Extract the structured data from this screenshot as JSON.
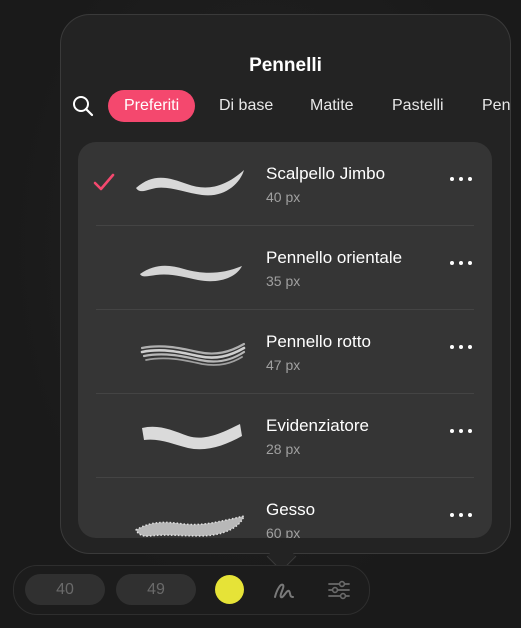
{
  "popover": {
    "title": "Pennelli"
  },
  "tabs": [
    {
      "label": "Preferiti",
      "active": true
    },
    {
      "label": "Di base",
      "active": false
    },
    {
      "label": "Matite",
      "active": false
    },
    {
      "label": "Pastelli",
      "active": false
    },
    {
      "label": "Pen",
      "active": false
    }
  ],
  "brushes": [
    {
      "name": "Scalpello Jimbo",
      "size": "40 px",
      "selected": true
    },
    {
      "name": "Pennello orientale",
      "size": "35 px",
      "selected": false
    },
    {
      "name": "Pennello rotto",
      "size": "47 px",
      "selected": false
    },
    {
      "name": "Evidenziatore",
      "size": "28 px",
      "selected": false
    },
    {
      "name": "Gesso",
      "size": "60 px",
      "selected": false
    }
  ],
  "toolbar": {
    "size_value": "40",
    "opacity_value": "49",
    "current_color": "#e6e337"
  },
  "colors": {
    "accent": "#f4486e"
  }
}
